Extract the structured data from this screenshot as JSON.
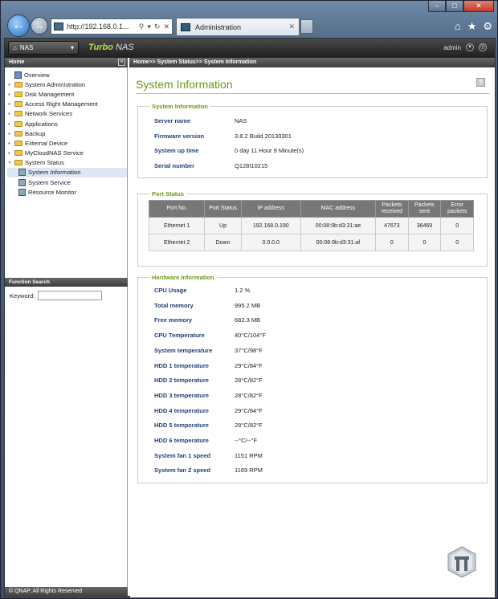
{
  "browser": {
    "address": "http://192.168.0.1...",
    "tab_title": "Administration",
    "window_buttons": [
      "–",
      "□",
      "✕"
    ]
  },
  "header": {
    "nas_label": "NAS",
    "brand_a": "Turbo",
    "brand_b": "NAS",
    "user": "admin"
  },
  "sidebar": {
    "home_label": "Home",
    "collapse_glyph": "«",
    "items": [
      {
        "label": "Overview",
        "type": "overview"
      },
      {
        "label": "System Administration",
        "type": "folder"
      },
      {
        "label": "Disk Management",
        "type": "folder"
      },
      {
        "label": "Access Right Management",
        "type": "folder"
      },
      {
        "label": "Network Services",
        "type": "folder"
      },
      {
        "label": "Applications",
        "type": "folder"
      },
      {
        "label": "Backup",
        "type": "folder"
      },
      {
        "label": "External Device",
        "type": "folder"
      },
      {
        "label": "MyCloudNAS Service",
        "type": "folder"
      },
      {
        "label": "System Status",
        "type": "folder-open"
      }
    ],
    "sub_items": [
      {
        "label": "System Information",
        "selected": true
      },
      {
        "label": "System Service",
        "selected": false
      },
      {
        "label": "Resource Monitor",
        "selected": false
      }
    ],
    "function_search": "Function Search",
    "keyword_label": "Keyword:",
    "footer": "© QNAP, All Rights Reserved"
  },
  "breadcrumb": "Home>> System Status>> System Information",
  "page_title": "System Information",
  "sysinfo": {
    "legend": "System Information",
    "rows": [
      {
        "k": "Server name",
        "v": "NAS"
      },
      {
        "k": "Firmware version",
        "v": "3.8.2 Build 20130301"
      },
      {
        "k": "System up time",
        "v": "0 day  11 Hour 9 Minute(s)"
      },
      {
        "k": "Serial number",
        "v": "Q128I10215"
      }
    ]
  },
  "port": {
    "legend": "Port Status",
    "headers": [
      "Port No.",
      "Port Status",
      "IP address",
      "MAC address",
      "Packets received",
      "Packets sent",
      "Error packets"
    ],
    "rows": [
      [
        "Ethernet 1",
        "Up",
        "192.168.0.190",
        "00:08:9b:d3:31:ae",
        "47673",
        "36469",
        "0"
      ],
      [
        "Ethernet 2",
        "Down",
        "0.0.0.0",
        "00:08:9b:d3:31:af",
        "0",
        "0",
        "0"
      ]
    ]
  },
  "hw": {
    "legend": "Hardware Information",
    "rows": [
      {
        "k": "CPU Usage",
        "v": "1.2 %"
      },
      {
        "k": "Total memory",
        "v": "995.2 MB"
      },
      {
        "k": "Free memory",
        "v": "682.3 MB"
      },
      {
        "k": "CPU Temperature",
        "v": "40°C/104°F"
      },
      {
        "k": "System temperature",
        "v": "37°C/98°F"
      },
      {
        "k": "HDD 1 temperature",
        "v": "29°C/84°F"
      },
      {
        "k": "HDD 2 temperature",
        "v": "28°C/82°F"
      },
      {
        "k": "HDD 3 temperature",
        "v": "28°C/82°F"
      },
      {
        "k": "HDD 4 temperature",
        "v": "29°C/84°F"
      },
      {
        "k": "HDD 5 temperature",
        "v": "28°C/82°F"
      },
      {
        "k": "HDD 6 temperature",
        "v": "--°C/--°F"
      },
      {
        "k": "System fan 1 speed",
        "v": "1151 RPM"
      },
      {
        "k": "System fan 2 speed",
        "v": "1169 RPM"
      }
    ]
  },
  "colors": {
    "accent_green": "#6a9a1a",
    "label_blue": "#1f3f7a"
  }
}
